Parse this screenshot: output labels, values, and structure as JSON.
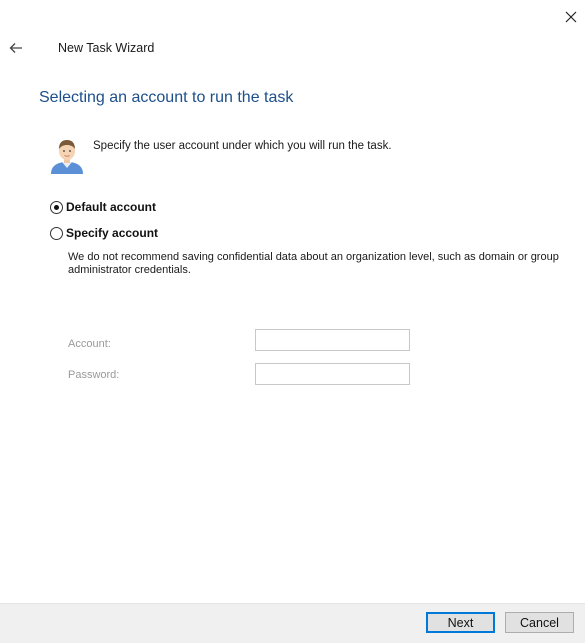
{
  "window": {
    "title": "New Task Wizard"
  },
  "page": {
    "heading": "Selecting an account to run the task",
    "intro": "Specify the user account under which you will run the task."
  },
  "options": {
    "default_label": "Default account",
    "specify_label": "Specify account",
    "selected": "default",
    "warning": "We do not recommend saving confidential data about an organization level, such as domain or group administrator credentials."
  },
  "fields": {
    "account_label": "Account:",
    "account_value": "",
    "password_label": "Password:",
    "password_value": ""
  },
  "footer": {
    "next_label": "Next",
    "cancel_label": "Cancel"
  },
  "icons": {
    "close": "close-icon",
    "back": "arrow-left-icon",
    "avatar": "user-avatar-icon"
  }
}
